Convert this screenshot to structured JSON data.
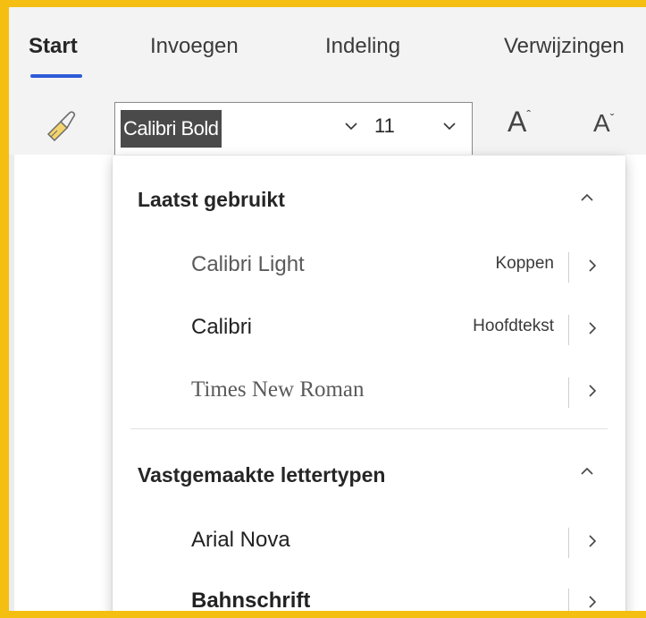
{
  "tabs": [
    {
      "label": "Start",
      "active": true
    },
    {
      "label": "Invoegen",
      "active": false
    },
    {
      "label": "Indeling",
      "active": false
    },
    {
      "label": "Verwijzingen",
      "active": false
    }
  ],
  "toolbar": {
    "format_painter_icon": "paintbrush-icon",
    "font_name_value": "Calibri Bold",
    "font_size_value": "11",
    "grow_font_label": "A",
    "shrink_font_label": "A"
  },
  "dropdown": {
    "sections": [
      {
        "title": "Laatst gebruikt",
        "items": [
          {
            "name": "Calibri Light",
            "tag": "Koppen"
          },
          {
            "name": "Calibri",
            "tag": "Hoofdtekst"
          },
          {
            "name": "Times New Roman",
            "tag": ""
          }
        ]
      },
      {
        "title": "Vastgemaakte lettertypen",
        "items": [
          {
            "name": "Arial Nova",
            "tag": ""
          },
          {
            "name": "Bahnschrift",
            "tag": ""
          }
        ]
      }
    ]
  },
  "colors": {
    "highlight_border": "#f5bf12",
    "active_tab_underline": "#2c5bd8",
    "selection_background": "#4a4a4a"
  }
}
